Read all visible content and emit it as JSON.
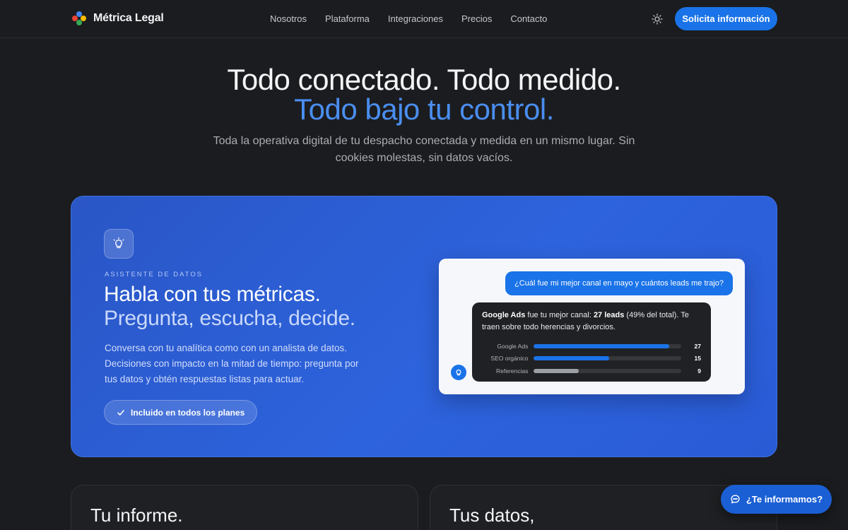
{
  "nav": {
    "brand": "Métrica Legal",
    "links": [
      "Nosotros",
      "Plataforma",
      "Integraciones",
      "Precios",
      "Contacto"
    ],
    "theme_icon": "sun-icon",
    "cta_label": "Solicita información"
  },
  "hero": {
    "title_line1": "Todo conectado. Todo medido.",
    "title_line2": "Todo bajo tu control.",
    "subtitle": "Toda la operativa digital de tu despacho conectada y medida en un mismo lugar. Sin cookies molestas, sin datos vacíos."
  },
  "feature": {
    "icon": "lightbulb-icon",
    "eyebrow": "ASISTENTE DE DATOS",
    "title_line1": "Habla con tus métricas.",
    "title_line2": "Pregunta, escucha, decide.",
    "description": "Conversa con tu analítica como con un analista de datos. Decisiones con impacto en la mitad de tiempo: pregunta por tus datos y obtén respuestas listas para actuar.",
    "pill_label": "Incluido en todos los planes",
    "chat": {
      "user_question": "¿Cuál fue mi mejor canal en mayo y cuántos leads me trajo?",
      "answer_channel": "Google Ads",
      "answer_mid": " fue tu mejor canal: ",
      "answer_leads": "27 leads",
      "answer_rest": " (49% del total). Te traen sobre todo herencias y divorcios.",
      "bars": [
        {
          "label": "Google Ads",
          "value": 27,
          "color": "#1a73e8"
        },
        {
          "label": "SEO orgánico",
          "value": 15,
          "color": "#1a73e8"
        },
        {
          "label": "Referencias",
          "value": 9,
          "color": "#9aa0a6"
        }
      ]
    }
  },
  "cards": {
    "left_title": "Tu informe.",
    "right_title": "Tus datos,"
  },
  "launcher": {
    "label": "¿Te informamos?",
    "icon": "chat-bubble-icon"
  }
}
